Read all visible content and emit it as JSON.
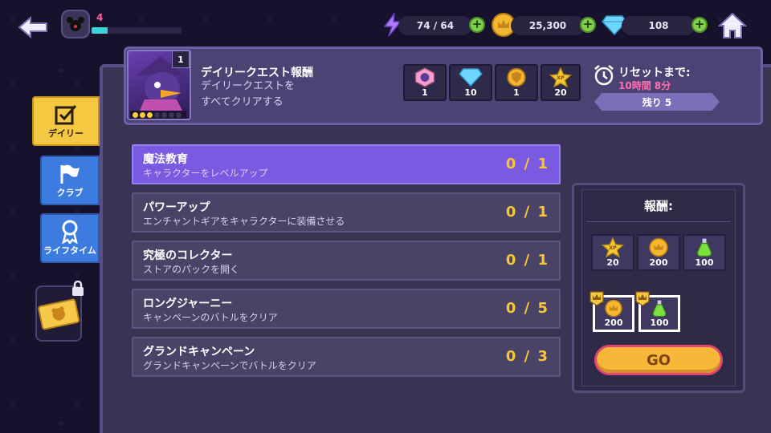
{
  "top_bar": {
    "player_level": "4",
    "xp_fraction": 0.18,
    "energy": "74 ∕ 64",
    "gold": "25,300",
    "gems": "108"
  },
  "side_tabs": {
    "daily": "デイリー",
    "club": "クラブ",
    "lifetime": "ライフタイム"
  },
  "header": {
    "hero_count": "1",
    "hero_stars": 3,
    "title": "デイリークエスト報酬",
    "description_line1": "デイリークエストを",
    "description_line2": "すべてクリアする",
    "rewards": [
      {
        "icon": "hero-token-icon",
        "amount": "1"
      },
      {
        "icon": "gem-icon",
        "amount": "10"
      },
      {
        "icon": "shield-token-icon",
        "amount": "1"
      },
      {
        "icon": "xp-star-icon",
        "amount": "20"
      }
    ],
    "reset_label": "リセットまで:",
    "reset_time": "10時間 8分",
    "remaining": "残り 5"
  },
  "quests": [
    {
      "name": "魔法教育",
      "desc": "キャラクターをレベルアップ",
      "progress": "0 ∕ 1"
    },
    {
      "name": "パワーアップ",
      "desc": "エンチャントギアをキャラクターに装備させる",
      "progress": "0 ∕ 1"
    },
    {
      "name": "究極のコレクター",
      "desc": "ストアのパックを開く",
      "progress": "0 ∕ 1"
    },
    {
      "name": "ロングジャーニー",
      "desc": "キャンペーンのバトルをクリア",
      "progress": "0 ∕ 5"
    },
    {
      "name": "グランドキャンペーン",
      "desc": "グランドキャンペーンでバトルをクリア",
      "progress": "0 ∕ 3"
    }
  ],
  "reward_panel": {
    "heading": "報酬:",
    "items": [
      {
        "icon": "xp-star-icon",
        "amount": "20"
      },
      {
        "icon": "gold-coin-icon",
        "amount": "200"
      },
      {
        "icon": "green-potion-icon",
        "amount": "100"
      }
    ],
    "vip_items": [
      {
        "icon": "gold-coin-icon",
        "amount": "200"
      },
      {
        "icon": "green-potion-icon",
        "amount": "100"
      }
    ],
    "go_label": "GO"
  },
  "colors": {
    "accent_purple": "#7a5ae0",
    "progress_yellow": "#f7c733",
    "go_button": "#f7b83a",
    "tab_daily": "#f5c842",
    "tab_blue": "#3c7be0"
  }
}
